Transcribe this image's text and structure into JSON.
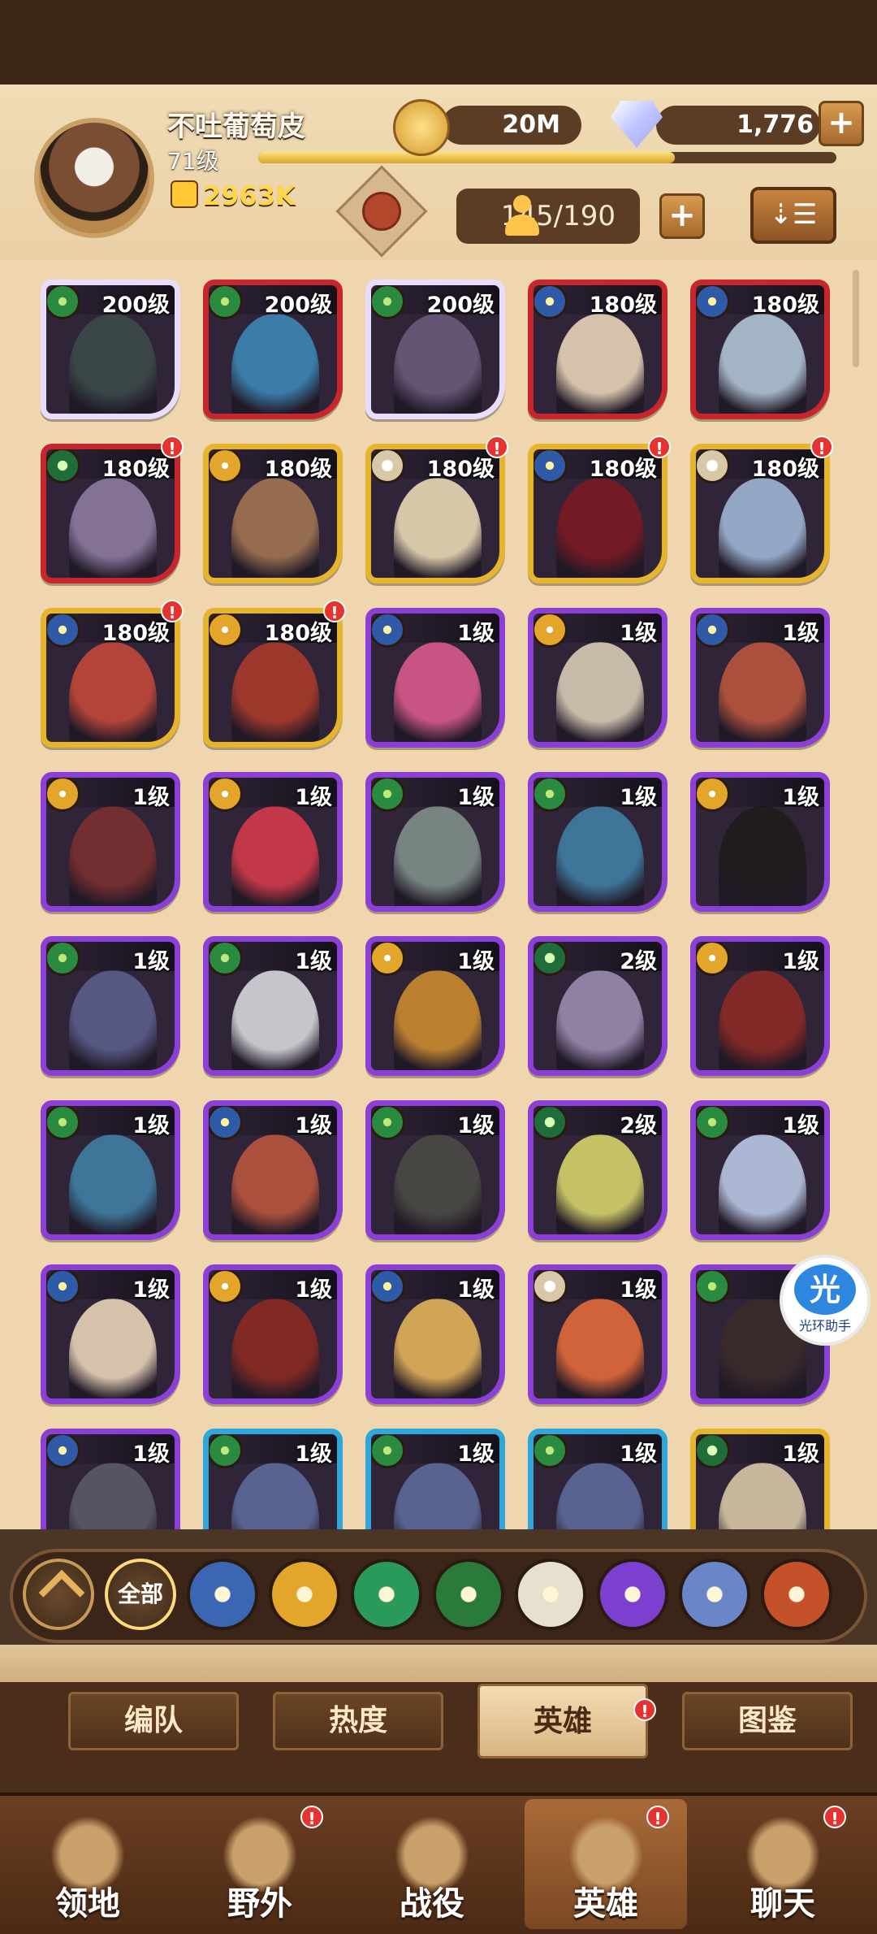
{
  "player": {
    "name": "不吐葡萄皮",
    "level": "71级",
    "power": "2963K",
    "xp_progress": 0.72
  },
  "currencies": {
    "gold": "20M",
    "diamonds": "1,776"
  },
  "hero_capacity": "145/190",
  "heroes": [
    {
      "level": "200级",
      "faction": "green",
      "rarity": "white",
      "portrait": "#3b4a4a"
    },
    {
      "level": "200级",
      "faction": "green",
      "rarity": "red",
      "portrait": "#3c86b5"
    },
    {
      "level": "200级",
      "faction": "green",
      "rarity": "white",
      "portrait": "#6b5a7a"
    },
    {
      "level": "180级",
      "faction": "blue",
      "rarity": "red",
      "portrait": "#e8d4b8"
    },
    {
      "level": "180级",
      "faction": "blue",
      "rarity": "red",
      "portrait": "#b0c4d4"
    },
    {
      "level": "180级",
      "faction": "lime",
      "rarity": "red",
      "portrait": "#8d7aa0",
      "badge": "!"
    },
    {
      "level": "180级",
      "faction": "gold",
      "rarity": "gold",
      "portrait": "#a17452"
    },
    {
      "level": "180级",
      "faction": "star",
      "rarity": "gold",
      "portrait": "#e9d9b5",
      "badge": "!"
    },
    {
      "level": "180级",
      "faction": "blue",
      "rarity": "gold",
      "portrait": "#7a1a22",
      "badge": "!"
    },
    {
      "level": "180级",
      "faction": "star",
      "rarity": "gold",
      "portrait": "#9fb7d6",
      "badge": "!"
    },
    {
      "level": "180级",
      "faction": "blue",
      "rarity": "gold",
      "portrait": "#c0483a",
      "badge": "!"
    },
    {
      "level": "180级",
      "faction": "gold",
      "rarity": "gold",
      "portrait": "#a83a2a",
      "badge": "!"
    },
    {
      "level": "1级",
      "faction": "blue",
      "rarity": "purple",
      "portrait": "#d85a8b"
    },
    {
      "level": "1级",
      "faction": "gold",
      "rarity": "purple",
      "portrait": "#d8cbb4"
    },
    {
      "level": "1级",
      "faction": "blue",
      "rarity": "purple",
      "portrait": "#b8553d"
    },
    {
      "level": "1级",
      "faction": "gold",
      "rarity": "purple",
      "portrait": "#7a2f2f"
    },
    {
      "level": "1级",
      "faction": "gold",
      "rarity": "purple",
      "portrait": "#d33a4a"
    },
    {
      "level": "1级",
      "faction": "green",
      "rarity": "purple",
      "portrait": "#7f8f8a"
    },
    {
      "level": "1级",
      "faction": "green",
      "rarity": "purple",
      "portrait": "#3f7ea3"
    },
    {
      "level": "1级",
      "faction": "gold",
      "rarity": "purple",
      "portrait": "#1f1b1b"
    },
    {
      "level": "1级",
      "faction": "green",
      "rarity": "purple",
      "portrait": "#5a5e8a"
    },
    {
      "level": "1级",
      "faction": "green",
      "rarity": "purple",
      "portrait": "#d6d8dc"
    },
    {
      "level": "1级",
      "faction": "gold",
      "rarity": "purple",
      "portrait": "#c98a2f"
    },
    {
      "level": "2级",
      "faction": "lime",
      "rarity": "purple",
      "portrait": "#9a8ab0"
    },
    {
      "level": "1级",
      "faction": "gold",
      "rarity": "purple",
      "portrait": "#8a2a25"
    },
    {
      "level": "1级",
      "faction": "green",
      "rarity": "purple",
      "portrait": "#3f7ea3"
    },
    {
      "level": "1级",
      "faction": "blue",
      "rarity": "purple",
      "portrait": "#b8553d"
    },
    {
      "level": "1级",
      "faction": "green",
      "rarity": "purple",
      "portrait": "#4a4a44"
    },
    {
      "level": "2级",
      "faction": "lime",
      "rarity": "purple",
      "portrait": "#d6d36a"
    },
    {
      "level": "1级",
      "faction": "green",
      "rarity": "purple",
      "portrait": "#b9c7e4"
    },
    {
      "level": "1级",
      "faction": "blue",
      "rarity": "purple",
      "portrait": "#e8d4b8"
    },
    {
      "level": "1级",
      "faction": "gold",
      "rarity": "purple",
      "portrait": "#8a2a22"
    },
    {
      "level": "1级",
      "faction": "blue",
      "rarity": "purple",
      "portrait": "#e3b35a"
    },
    {
      "level": "1级",
      "faction": "star",
      "rarity": "purple",
      "portrait": "#e36a3a"
    },
    {
      "level": "1级",
      "faction": "green",
      "rarity": "purple",
      "portrait": "#3a2a2a"
    },
    {
      "level": "1级",
      "faction": "blue",
      "rarity": "purple",
      "portrait": "#5a5a66"
    },
    {
      "level": "1级",
      "faction": "green",
      "rarity": "blue",
      "portrait": "#5d6a9a"
    },
    {
      "level": "1级",
      "faction": "green",
      "rarity": "blue",
      "portrait": "#5d6a9a"
    },
    {
      "level": "1级",
      "faction": "green",
      "rarity": "blue",
      "portrait": "#5d6a9a"
    },
    {
      "level": "1级",
      "faction": "lime",
      "rarity": "gold",
      "portrait": "#d7c7a7"
    }
  ],
  "faction_filters": [
    {
      "id": "collapse",
      "icon": "chevron-up-icon"
    },
    {
      "id": "all",
      "label": "全部"
    },
    {
      "id": "lightbearer",
      "icon": "compass-star-icon",
      "color": "#3b66b3"
    },
    {
      "id": "mauler",
      "icon": "sun-emblem-icon",
      "color": "#e3a52a"
    },
    {
      "id": "wilder",
      "icon": "leaf-icon",
      "color": "#2a9a5a"
    },
    {
      "id": "graveborn",
      "icon": "eye-icon",
      "color": "#2a7a3a"
    },
    {
      "id": "celestial",
      "icon": "starburst-icon",
      "color": "#e8e0cf"
    },
    {
      "id": "hypogean",
      "icon": "dark-crest-icon",
      "color": "#7c3fd0"
    },
    {
      "id": "dimensional",
      "icon": "orb-icon",
      "color": "#6a86c8"
    },
    {
      "id": "dragon",
      "icon": "flame-crest-icon",
      "color": "#c4512a"
    }
  ],
  "sub_tabs": [
    {
      "label": "编队"
    },
    {
      "label": "热度"
    },
    {
      "label": "英雄",
      "active": true,
      "badge": "!"
    },
    {
      "label": "图鉴"
    }
  ],
  "bottom_nav": [
    {
      "label": "领地",
      "icon": "castle-icon"
    },
    {
      "label": "野外",
      "icon": "map-scroll-icon",
      "badge": "!"
    },
    {
      "label": "战役",
      "icon": "sword-shield-icon"
    },
    {
      "label": "英雄",
      "icon": "helmet-icon",
      "active": true,
      "badge": "!"
    },
    {
      "label": "聊天",
      "icon": "chat-bubble-icon",
      "badge": "!"
    }
  ],
  "assistant": {
    "glyph": "光",
    "label": "光环助手"
  }
}
